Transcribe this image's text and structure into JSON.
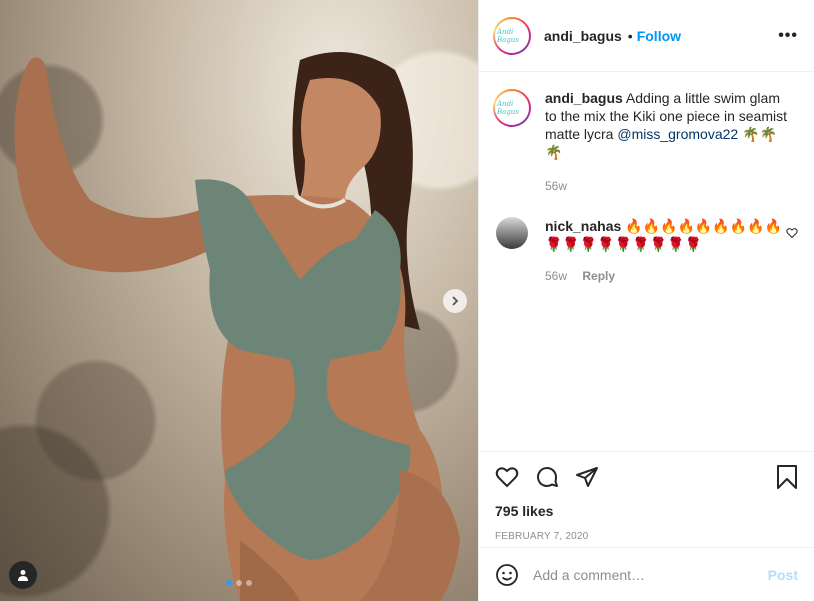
{
  "post": {
    "author": "andi_bagus",
    "avatar_text": "Andi Bagus",
    "separator": "•",
    "follow_label": "Follow",
    "more_label": "•••"
  },
  "caption": {
    "author": "andi_bagus",
    "text": "Adding a little swim glam to the mix the Kiki one piece in seamist matte lycra",
    "mention": "@miss_gromova22",
    "emoji": "🌴🌴🌴",
    "age": "56w"
  },
  "comments": [
    {
      "author": "nick_nahas",
      "text": "🔥🔥🔥🔥🔥🔥🔥🔥🔥🌹🌹🌹🌹🌹🌹🌹🌹🌹",
      "age": "56w",
      "reply_label": "Reply"
    }
  ],
  "actions": {
    "likes": "795 likes",
    "date": "FEBRUARY 7, 2020"
  },
  "composer": {
    "placeholder": "Add a comment…",
    "post_label": "Post"
  },
  "carousel": {
    "slide_count": 3,
    "active_index": 0
  },
  "colors": {
    "follow": "#0095f6",
    "post_disabled": "#b2dffc",
    "active_dot": "#3897f0"
  }
}
